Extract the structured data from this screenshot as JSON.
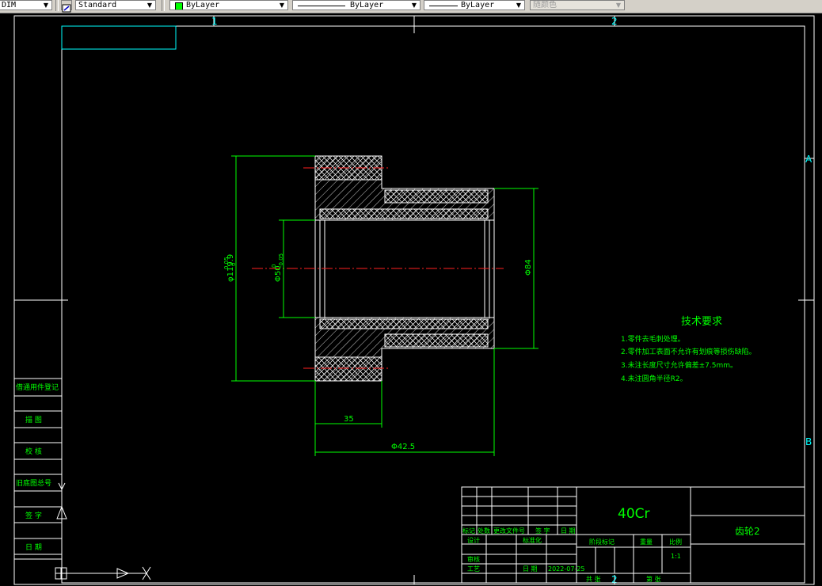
{
  "toolbar": {
    "dimstyle": "DIM",
    "textstyle": "Standard",
    "layer_color": "ByLayer",
    "linetype": "ByLayer",
    "lineweight": "ByLayer",
    "plotstyle": "随颜色",
    "colors": {
      "layer_swatch": "#00ff00"
    }
  },
  "frame": {
    "zone_top_1": "1",
    "zone_top_2": "2",
    "zone_bottom_2": "2",
    "zone_right_a": "A",
    "zone_right_b": "B"
  },
  "dimensions": {
    "outer_diameter": "φ119.9",
    "outer_tol_upper": "0.05",
    "outer_tol_lower": "0",
    "bore_diameter": "Φ50",
    "bore_tol_upper": "0",
    "bore_tol_lower": "-0.05",
    "hub_diameter": "Φ84",
    "flange_width": "35",
    "total_length": "Φ42.5"
  },
  "tech_requirements": {
    "title": "技术要求",
    "items": [
      "1.零件去毛刺处理。",
      "2.零件加工表面不允许有划痕等损伤缺陷。",
      "3.未注长度尺寸允许偏差±7.5mm。",
      "4.未注圆角半径R2。"
    ]
  },
  "left_table": {
    "rows": [
      "借通用件登记",
      "描  图",
      "校  核",
      "旧底图总号",
      "签  字",
      "日  期"
    ]
  },
  "title_block": {
    "material": "40Cr",
    "part_name": "齿轮2",
    "row_labels": [
      "标记",
      "处数",
      "更改文件号",
      "签 字",
      "日 期"
    ],
    "designer_label": "设计",
    "standardization_label": "标准化",
    "check_label": "审核",
    "process_label": "工艺",
    "date_label": "日 期",
    "date_value": "2022-07-25",
    "stage_label": "阶段标记",
    "weight_label": "重量",
    "scale_label": "比例",
    "scale_value": "1:1",
    "sheets_label": "共  张",
    "sheet_label": "第  张"
  }
}
